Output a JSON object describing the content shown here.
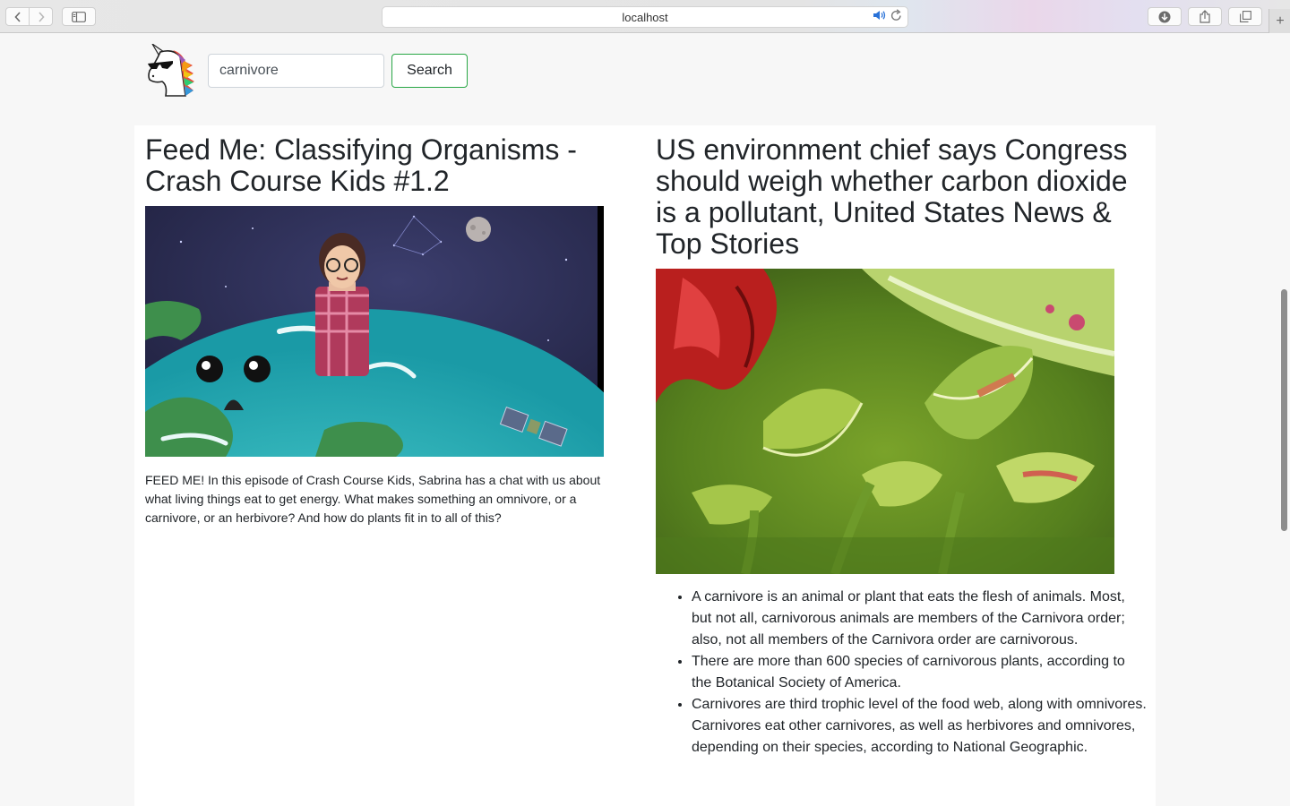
{
  "browser": {
    "url": "localhost",
    "back_icon": "chevron-left-icon",
    "forward_icon": "chevron-right-icon",
    "new_tab_label": "+"
  },
  "search": {
    "value": "carnivore",
    "button_label": "Search"
  },
  "results": [
    {
      "title": "Feed Me: Classifying Organisms - Crash Course Kids #1.2",
      "description": "FEED ME! In this episode of Crash Course Kids, Sabrina has a chat with us about what living things eat to get energy. What makes something an omnivore, or a carnivore, or an herbivore? And how do plants fit in to all of this?"
    },
    {
      "title": "US environment chief says Congress should weigh whether carbon dioxide is a pollutant, United States News & Top Stories",
      "bullets": [
        "A carnivore is an animal or plant that eats the flesh of animals. Most, but not all, carnivorous animals are members of the Carnivora order; also, not all members of the Carnivora order are carnivorous.",
        "There are more than 600 species of carnivorous plants, according to the Botanical Society of America.",
        "Carnivores are third trophic level of the food web, along with omnivores. Carnivores eat other carnivores, as well as herbivores and omnivores, depending on their species, according to National Geographic."
      ]
    }
  ]
}
